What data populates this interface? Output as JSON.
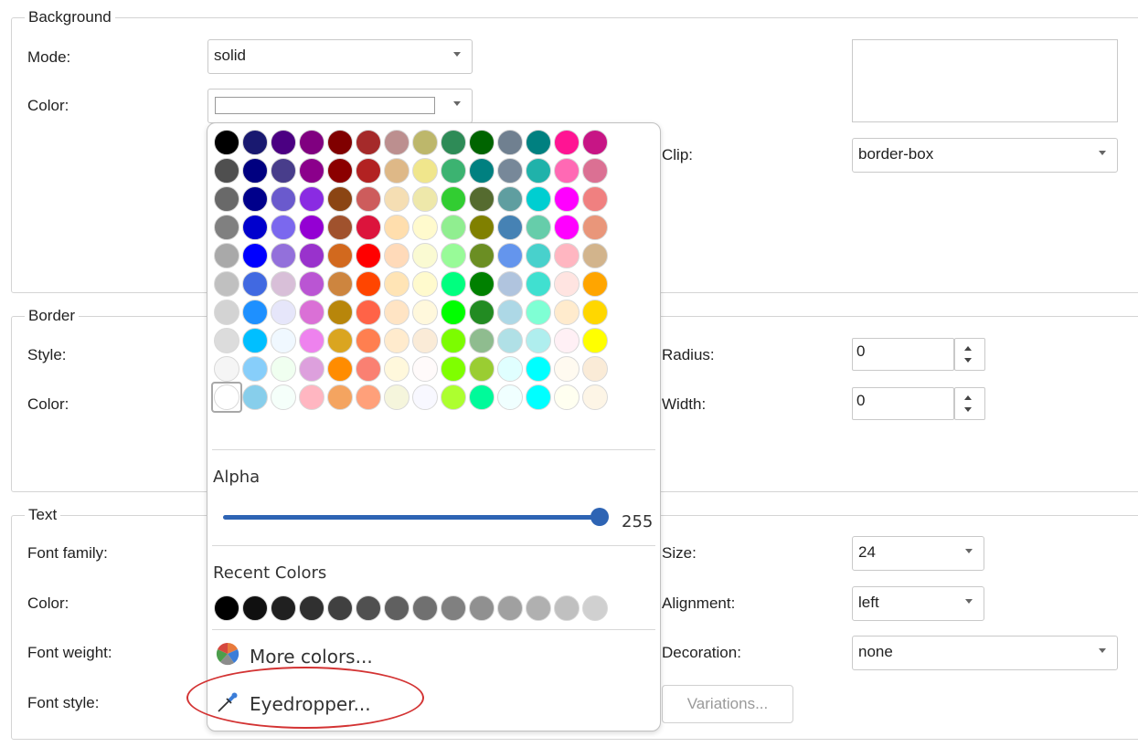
{
  "background": {
    "legend": "Background",
    "mode_label": "Mode:",
    "mode_value": "solid",
    "color_label": "Color:",
    "clip_label": "Clip:",
    "clip_value": "border-box"
  },
  "border": {
    "legend": "Border",
    "style_label": "Style:",
    "color_label": "Color:",
    "radius_label": "Radius:",
    "radius_value": "0",
    "width_label": "Width:",
    "width_value": "0"
  },
  "text": {
    "legend": "Text",
    "font_family_label": "Font family:",
    "color_label": "Color:",
    "font_weight_label": "Font weight:",
    "font_style_label": "Font style:",
    "size_label": "Size:",
    "size_value": "24",
    "alignment_label": "Alignment:",
    "alignment_value": "left",
    "decoration_label": "Decoration:",
    "decoration_value": "none",
    "variations_button": "Variations..."
  },
  "popup": {
    "palette": [
      [
        "#000000",
        "#191970",
        "#4b0082",
        "#800080",
        "#800000",
        "#a52a2a",
        "#bc8f8f",
        "#bdb76b",
        "#2e8b57",
        "#006400",
        "#708090",
        "#008080",
        "#ff1493",
        "#c71585"
      ],
      [
        "#4f4f4f",
        "#000080",
        "#483d8b",
        "#8b008b",
        "#8b0000",
        "#b22222",
        "#deb887",
        "#f0e68c",
        "#3cb371",
        "#008080",
        "#778899",
        "#20b2aa",
        "#ff69b4",
        "#db7093"
      ],
      [
        "#696969",
        "#00008b",
        "#6a5acd",
        "#8a2be2",
        "#8b4513",
        "#cd5c5c",
        "#f5deb3",
        "#eee8aa",
        "#32cd32",
        "#556b2f",
        "#5f9ea0",
        "#00ced1",
        "#ff00ff",
        "#f08080"
      ],
      [
        "#808080",
        "#0000cd",
        "#7b68ee",
        "#9400d3",
        "#a0522d",
        "#dc143c",
        "#ffdead",
        "#fffacd",
        "#90ee90",
        "#808000",
        "#4682b4",
        "#66cdaa",
        "#ff00ff",
        "#e9967a"
      ],
      [
        "#a9a9a9",
        "#0000ff",
        "#9370db",
        "#9932cc",
        "#d2691e",
        "#ff0000",
        "#ffdab9",
        "#fafad2",
        "#98fb98",
        "#6b8e23",
        "#6495ed",
        "#48d1cc",
        "#ffb6c1",
        "#d2b48c"
      ],
      [
        "#c0c0c0",
        "#4169e1",
        "#d8bfd8",
        "#ba55d3",
        "#cd853f",
        "#ff4500",
        "#ffe4b5",
        "#fffacd",
        "#00ff7f",
        "#008000",
        "#b0c4de",
        "#40e0d0",
        "#ffe4e1",
        "#ffa500"
      ],
      [
        "#d3d3d3",
        "#1e90ff",
        "#e6e6fa",
        "#da70d6",
        "#b8860b",
        "#ff6347",
        "#ffe4c4",
        "#fff8dc",
        "#00ff00",
        "#228b22",
        "#add8e6",
        "#7fffd4",
        "#ffebcd",
        "#ffd700"
      ],
      [
        "#dcdcdc",
        "#00bfff",
        "#f0f8ff",
        "#ee82ee",
        "#daa520",
        "#ff7f50",
        "#ffebcd",
        "#faebd7",
        "#7cfc00",
        "#8fbc8f",
        "#b0e0e6",
        "#afeeee",
        "#fff0f5",
        "#ffff00"
      ],
      [
        "#f5f5f5",
        "#87cefa",
        "#f0fff0",
        "#dda0dd",
        "#ff8c00",
        "#fa8072",
        "#fff8dc",
        "#fffafa",
        "#7fff00",
        "#9acd32",
        "#e0ffff",
        "#00ffff",
        "#fffaf0",
        "#faebd7"
      ],
      [
        "#ffffff",
        "#87ceeb",
        "#f5fffa",
        "#ffb6c1",
        "#f4a460",
        "#ffa07a",
        "#f5f5dc",
        "#f8f8ff",
        "#adff2f",
        "#00fa9a",
        "#f0ffff",
        "#00ffff",
        "#fffff0",
        "#fdf5e6"
      ]
    ],
    "alpha_label": "Alpha",
    "alpha_value": "255",
    "alpha_fraction": 1.0,
    "recent_label": "Recent Colors",
    "recent_colors": [
      "#000000",
      "#101010",
      "#202020",
      "#303030",
      "#404040",
      "#505050",
      "#606060",
      "#707070",
      "#808080",
      "#909090",
      "#a0a0a0",
      "#b0b0b0",
      "#c0c0c0",
      "#d0d0d0"
    ],
    "more_colors": "More colors...",
    "more_colors_icon": "palette-icon",
    "eyedropper": "Eyedropper...",
    "eyedropper_icon": "eyedropper-icon",
    "highlight_color": "#d33333"
  }
}
